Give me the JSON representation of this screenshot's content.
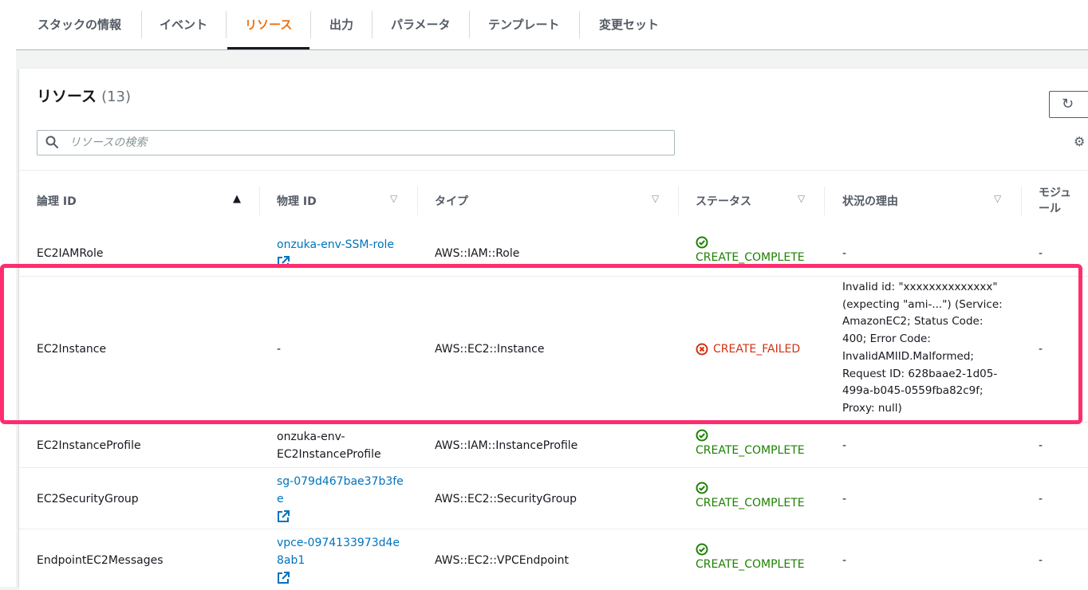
{
  "tabs": [
    {
      "label": "スタックの情報",
      "active": false
    },
    {
      "label": "イベント",
      "active": false
    },
    {
      "label": "リソース",
      "active": true
    },
    {
      "label": "出力",
      "active": false
    },
    {
      "label": "パラメータ",
      "active": false
    },
    {
      "label": "テンプレート",
      "active": false
    },
    {
      "label": "変更セット",
      "active": false
    }
  ],
  "panel": {
    "title": "リソース",
    "count": "(13)",
    "search_placeholder": "リソースの検索",
    "refresh_icon": "refresh-icon",
    "settings_icon": "gear-icon"
  },
  "columns": [
    {
      "label": "論理 ID",
      "sort": "ascending"
    },
    {
      "label": "物理 ID",
      "sort": "none"
    },
    {
      "label": "タイプ",
      "sort": "none"
    },
    {
      "label": "ステータス",
      "sort": "none"
    },
    {
      "label": "状況の理由",
      "sort": "none"
    },
    {
      "label": "モジュール"
    }
  ],
  "rows": [
    {
      "logical_id": "EC2IAMRole",
      "physical_id": "onzuka-env-SSM-role",
      "physical_link": true,
      "type": "AWS::IAM::Role",
      "status": "CREATE_COMPLETE",
      "status_kind": "ok",
      "reason": "-",
      "module": "-"
    },
    {
      "logical_id": "EC2Instance",
      "physical_id": "-",
      "physical_link": false,
      "type": "AWS::EC2::Instance",
      "status": "CREATE_FAILED",
      "status_kind": "fail",
      "reason": "Invalid id: \"xxxxxxxxxxxxxx\" (expecting \"ami-...\") (Service: AmazonEC2; Status Code: 400; Error Code: InvalidAMIID.Malformed; Request ID: 628baae2-1d05-499a-b045-0559fba82c9f; Proxy: null)",
      "module": "-"
    },
    {
      "logical_id": "EC2InstanceProfile",
      "physical_id": "onzuka-env-EC2InstanceProfile",
      "physical_link": false,
      "type": "AWS::IAM::InstanceProfile",
      "status": "CREATE_COMPLETE",
      "status_kind": "ok",
      "reason": "-",
      "module": "-"
    },
    {
      "logical_id": "EC2SecurityGroup",
      "physical_id": "sg-079d467bae37b3fee",
      "physical_link": true,
      "type": "AWS::EC2::SecurityGroup",
      "status": "CREATE_COMPLETE",
      "status_kind": "ok",
      "reason": "-",
      "module": "-"
    },
    {
      "logical_id": "EndpointEC2Messages",
      "physical_id": "vpce-0974133973d4e8ab1",
      "physical_link": true,
      "type": "AWS::EC2::VPCEndpoint",
      "status": "CREATE_COMPLETE",
      "status_kind": "ok",
      "reason": "-",
      "module": "-"
    }
  ],
  "colors": {
    "accent": "#ec7211",
    "link": "#0073bb",
    "success": "#1d8102",
    "error": "#d13212",
    "highlight": "#ff2d6f"
  }
}
